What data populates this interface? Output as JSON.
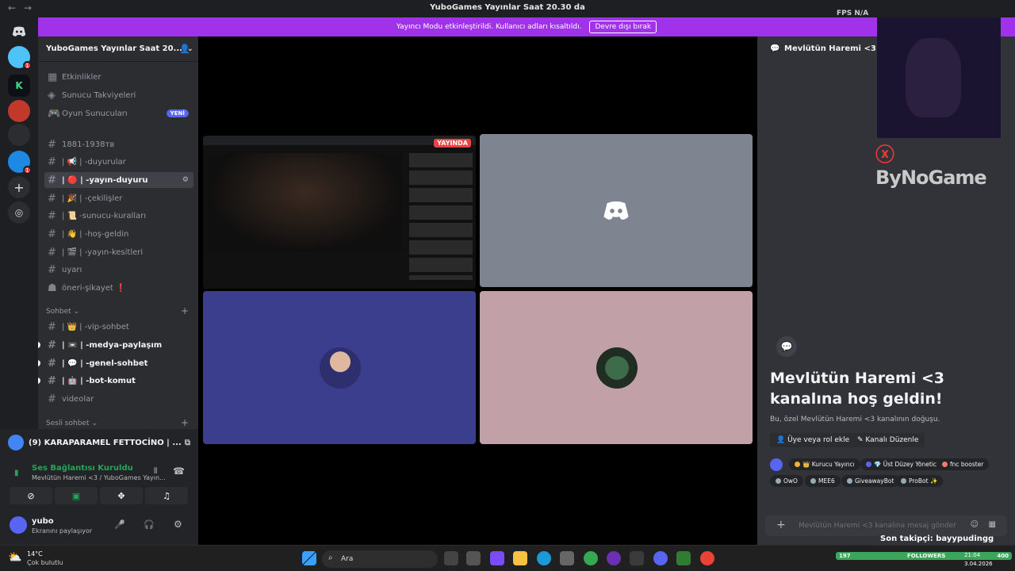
{
  "window": {
    "title": "YuboGames Yayınlar Saat 20.30 da",
    "fps_label": "FPS",
    "fps_value": "N/A"
  },
  "banner": {
    "text": "Yayıncı Modu etkinleştirildi. Kullanıcı adları kısaltıldı.",
    "button": "Devre dışı bırak"
  },
  "server": {
    "name": "YuboGames Yayınlar Saat 20..."
  },
  "sidebar": {
    "top_items": [
      {
        "label": "Etkinlikler"
      },
      {
        "label": "Sunucu Takviyeleri"
      },
      {
        "label": "Oyun Sunucuları",
        "badge": "YENİ"
      }
    ],
    "channels": [
      {
        "label": "1881-1938тв"
      },
      {
        "label": "| 📢 | -duyurular"
      },
      {
        "label": "| 🔴 | -yayın-duyuru"
      },
      {
        "label": "| 🎉 | -çekilişler"
      },
      {
        "label": "| 📜 -sunucu-kuralları"
      },
      {
        "label": "| 👋 | -hoş-geldin"
      },
      {
        "label": "| 🎬 | -yayın-kesitleri"
      },
      {
        "label": "uyarı"
      },
      {
        "label": "öneri-şikayet ❗"
      }
    ],
    "category_chat": "Sohbet",
    "chat_channels": [
      {
        "label": "| 👑 | -vip-sohbet"
      },
      {
        "label": "| 📼 | -medya-paylaşım"
      },
      {
        "label": "| 💬 | -genel-sohbet"
      },
      {
        "label": "| 🤖 | -bot-komut"
      },
      {
        "label": "videolar"
      }
    ],
    "category_voice": "Sesli sohbet"
  },
  "panel": {
    "dm": "(9) KARAPARAMEL FETTOCİNO | ...",
    "connection": "Ses Bağlantısı Kuruldu",
    "connection_sub": "Mevlütün Haremi <3 / YuboGames Yayın...",
    "user": "yubo",
    "status": "Ekranını paylaşıyor"
  },
  "stage": {
    "live_label": "YAYINDA"
  },
  "right": {
    "channel": "Mevlütün Haremi <3",
    "brand": "ByNoGame",
    "welcome": "Mevlütün Haremi <3 kanalına hoş geldin!",
    "welcome_sub": "Bu, özel Mevlütün Haremi <3 kanalının doğuşu.",
    "add_member": "Üye veya rol ekle",
    "edit_channel": "Kanalı Düzenle",
    "roles": [
      {
        "label": "👑 Kurucu Yayıncı",
        "color": "#f0b232"
      },
      {
        "label": "💎 Üst Düzey Yönetici",
        "color": "#5865f2"
      },
      {
        "label": "fnc booster",
        "color": "#f47b67"
      },
      {
        "label": "OwO",
        "color": "#99aab5"
      },
      {
        "label": "MEE6",
        "color": "#99aab5"
      },
      {
        "label": "GiveawayBot",
        "color": "#99aab5"
      },
      {
        "label": "ProBot ✨",
        "color": "#99aab5"
      }
    ],
    "message_placeholder": "Mevlütün Haremi <3 kanalına mesaj gönder"
  },
  "overlay": {
    "last_follower": "Son takipçi: bayypudingg",
    "followers_count": "197",
    "followers_label": "FOLLOWERS",
    "followers_goal": "400"
  },
  "taskbar": {
    "temp": "14°C",
    "weather": "Çok bulutlu",
    "search": "Ara",
    "time": "21:04",
    "date": "3.04.2026"
  },
  "colors": {
    "accent": "#5865f2",
    "banner": "#a033ea",
    "online": "#23a55a",
    "live": "#ed4245"
  }
}
